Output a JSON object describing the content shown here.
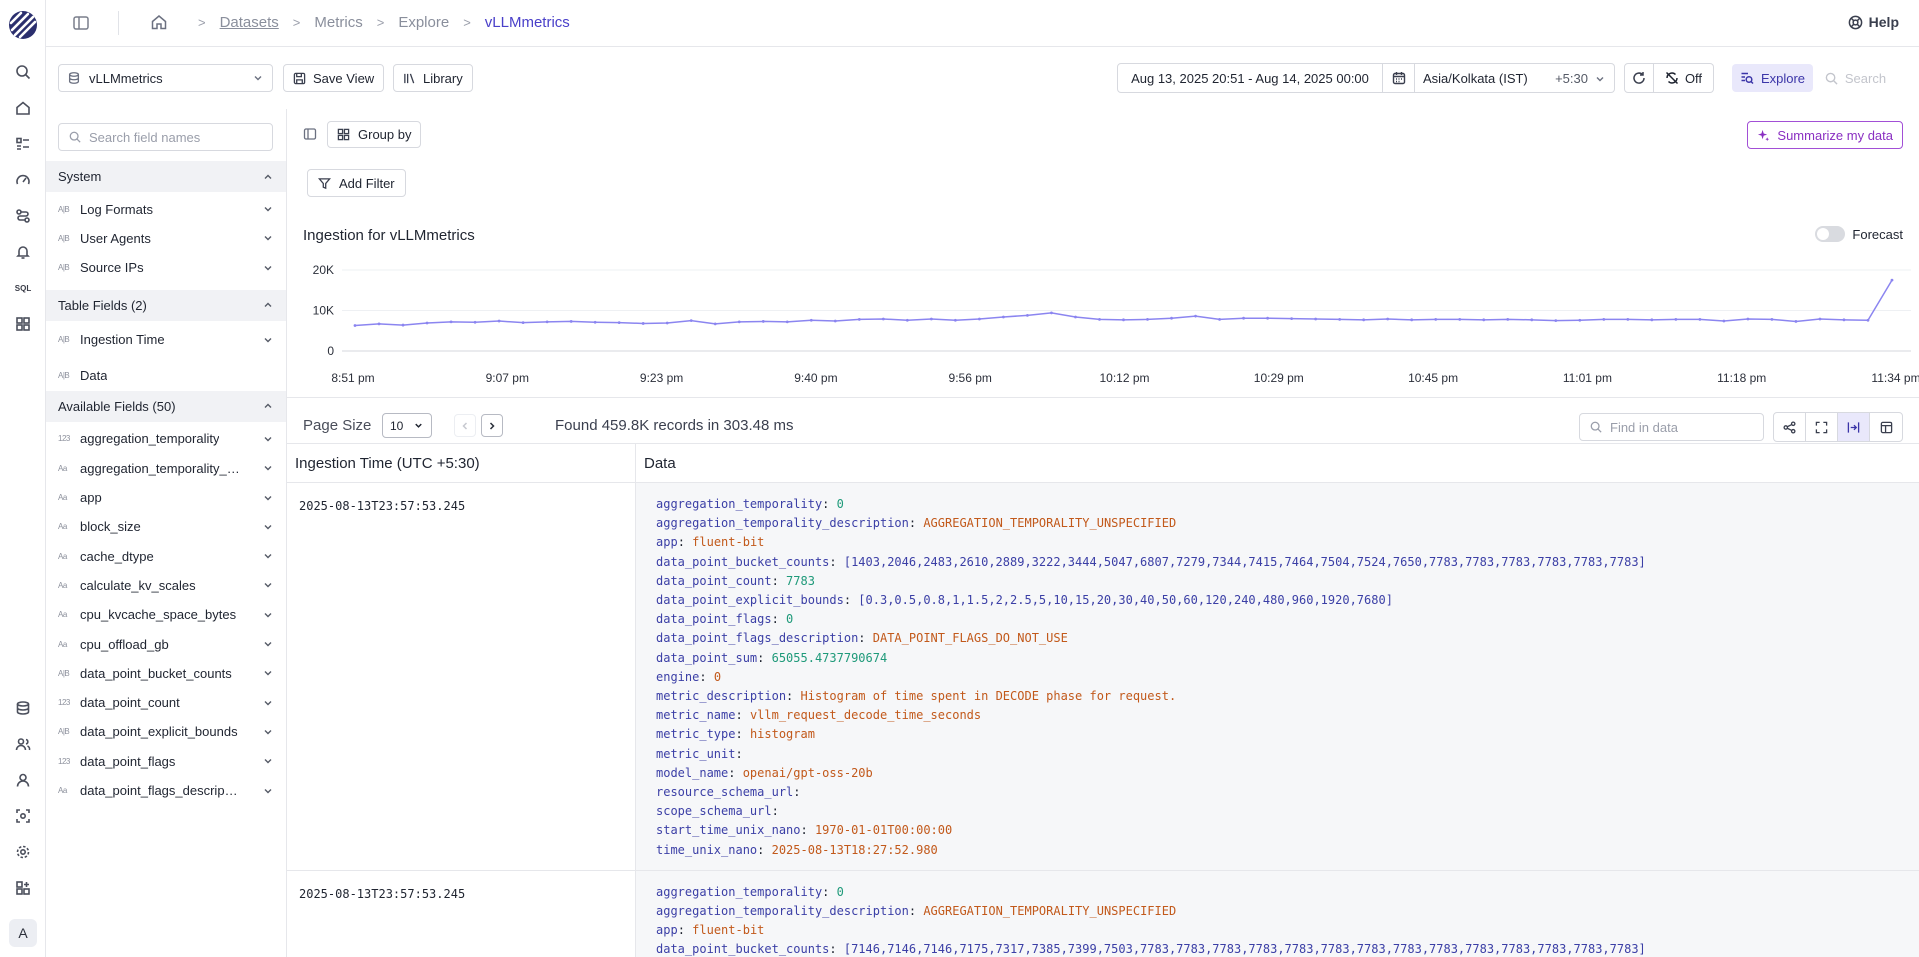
{
  "header": {
    "breadcrumbs": [
      "Datasets",
      "Metrics",
      "Explore",
      "vLLMmetrics"
    ],
    "help_label": "Help"
  },
  "toolbar": {
    "dataset": "vLLMmetrics",
    "save_view": "Save View",
    "library": "Library",
    "date_range": "Aug 13, 2025 20:51 - Aug 14, 2025 00:00",
    "timezone": "Asia/Kolkata (IST)",
    "tz_offset": "+5:30",
    "auto_refresh": "Off",
    "explore": "Explore",
    "search": "Search"
  },
  "fields": {
    "search_placeholder": "Search field names",
    "system_title": "System",
    "system": [
      {
        "type": "A|B",
        "name": "Log Formats"
      },
      {
        "type": "A|B",
        "name": "User Agents"
      },
      {
        "type": "A|B",
        "name": "Source IPs"
      }
    ],
    "table_title": "Table Fields (2)",
    "table": [
      {
        "type": "A|B",
        "name": "Ingestion Time"
      },
      {
        "type": "A|B",
        "name": "Data"
      }
    ],
    "available_title": "Available Fields (50)",
    "available": [
      {
        "type": "123",
        "name": "aggregation_temporality"
      },
      {
        "type": "Aa",
        "name": "aggregation_temporality_description"
      },
      {
        "type": "Aa",
        "name": "app"
      },
      {
        "type": "Aa",
        "name": "block_size"
      },
      {
        "type": "Aa",
        "name": "cache_dtype"
      },
      {
        "type": "Aa",
        "name": "calculate_kv_scales"
      },
      {
        "type": "Aa",
        "name": "cpu_kvcache_space_bytes"
      },
      {
        "type": "Aa",
        "name": "cpu_offload_gb"
      },
      {
        "type": "A|B",
        "name": "data_point_bucket_counts"
      },
      {
        "type": "123",
        "name": "data_point_count"
      },
      {
        "type": "A|B",
        "name": "data_point_explicit_bounds"
      },
      {
        "type": "123",
        "name": "data_point_flags"
      },
      {
        "type": "Aa",
        "name": "data_point_flags_description"
      }
    ]
  },
  "main": {
    "group_by": "Group by",
    "summarize": "Summarize my data",
    "add_filter": "Add Filter",
    "chart_title": "Ingestion for vLLMmetrics",
    "forecast": "Forecast",
    "page_size_label": "Page Size",
    "page_size": "10",
    "found": "Found 459.8K records in 303.48 ms",
    "find_placeholder": "Find in data",
    "col_time": "Ingestion Time (UTC +5:30)",
    "col_data": "Data"
  },
  "chart_data": {
    "type": "line",
    "title": "Ingestion for vLLMmetrics",
    "xlabel": "",
    "ylabel": "",
    "ylim": [
      0,
      20000
    ],
    "y_ticks": [
      "0",
      "10K",
      "20K"
    ],
    "x_ticks": [
      "8:51 pm",
      "9:07 pm",
      "9:23 pm",
      "9:40 pm",
      "9:56 pm",
      "10:12 pm",
      "10:29 pm",
      "10:45 pm",
      "11:01 pm",
      "11:18 pm",
      "11:34 pm"
    ],
    "color": "#8b85f0",
    "values": [
      6300,
      6700,
      6400,
      6900,
      7200,
      7100,
      7400,
      7000,
      7200,
      7300,
      7100,
      7000,
      6800,
      6900,
      7500,
      6700,
      7200,
      7300,
      7200,
      7600,
      7400,
      7800,
      7900,
      7600,
      7900,
      7600,
      7900,
      8400,
      8800,
      9400,
      8400,
      7800,
      7700,
      7800,
      8100,
      8600,
      7800,
      8100,
      8100,
      8000,
      7900,
      7800,
      7700,
      7900,
      7700,
      7800,
      7800,
      7700,
      7800,
      7700,
      7500,
      7600,
      7800,
      7800,
      7700,
      7800,
      7800,
      7400,
      7900,
      7800,
      7300,
      7900,
      7700,
      7600,
      17500
    ]
  },
  "rows": [
    {
      "time": "2025-08-13T23:57:53.245",
      "fields": [
        {
          "k": "aggregation_temporality",
          "v": "0",
          "t": "n"
        },
        {
          "k": "aggregation_temporality_description",
          "v": "AGGREGATION_TEMPORALITY_UNSPECIFIED",
          "t": "s"
        },
        {
          "k": "app",
          "v": "fluent-bit",
          "t": "s"
        },
        {
          "k": "data_point_bucket_counts",
          "v": "[1403,2046,2483,2610,2889,3222,3444,5047,6807,7279,7344,7415,7464,7504,7524,7650,7783,7783,7783,7783,7783,7783]",
          "t": "a"
        },
        {
          "k": "data_point_count",
          "v": "7783",
          "t": "n"
        },
        {
          "k": "data_point_explicit_bounds",
          "v": "[0.3,0.5,0.8,1,1.5,2,2.5,5,10,15,20,30,40,50,60,120,240,480,960,1920,7680]",
          "t": "a"
        },
        {
          "k": "data_point_flags",
          "v": "0",
          "t": "n"
        },
        {
          "k": "data_point_flags_description",
          "v": "DATA_POINT_FLAGS_DO_NOT_USE",
          "t": "s"
        },
        {
          "k": "data_point_sum",
          "v": "65055.4737790674",
          "t": "n"
        },
        {
          "k": "engine",
          "v": "0",
          "t": "s"
        },
        {
          "k": "metric_description",
          "v": "Histogram of time spent in DECODE phase for request.",
          "t": "s"
        },
        {
          "k": "metric_name",
          "v": "vllm_request_decode_time_seconds",
          "t": "s"
        },
        {
          "k": "metric_type",
          "v": "histogram",
          "t": "s"
        },
        {
          "k": "metric_unit",
          "v": "",
          "t": "s"
        },
        {
          "k": "model_name",
          "v": "openai/gpt-oss-20b",
          "t": "s"
        },
        {
          "k": "resource_schema_url",
          "v": "",
          "t": "s"
        },
        {
          "k": "scope_schema_url",
          "v": "",
          "t": "s"
        },
        {
          "k": "start_time_unix_nano",
          "v": "1970-01-01T00:00:00",
          "t": "s"
        },
        {
          "k": "time_unix_nano",
          "v": "2025-08-13T18:27:52.980",
          "t": "s"
        }
      ]
    },
    {
      "time": "2025-08-13T23:57:53.245",
      "fields": [
        {
          "k": "aggregation_temporality",
          "v": "0",
          "t": "n"
        },
        {
          "k": "aggregation_temporality_description",
          "v": "AGGREGATION_TEMPORALITY_UNSPECIFIED",
          "t": "s"
        },
        {
          "k": "app",
          "v": "fluent-bit",
          "t": "s"
        },
        {
          "k": "data_point_bucket_counts",
          "v": "[7146,7146,7146,7175,7317,7385,7399,7503,7783,7783,7783,7783,7783,7783,7783,7783,7783,7783,7783,7783,7783,7783]",
          "t": "a"
        }
      ]
    }
  ]
}
